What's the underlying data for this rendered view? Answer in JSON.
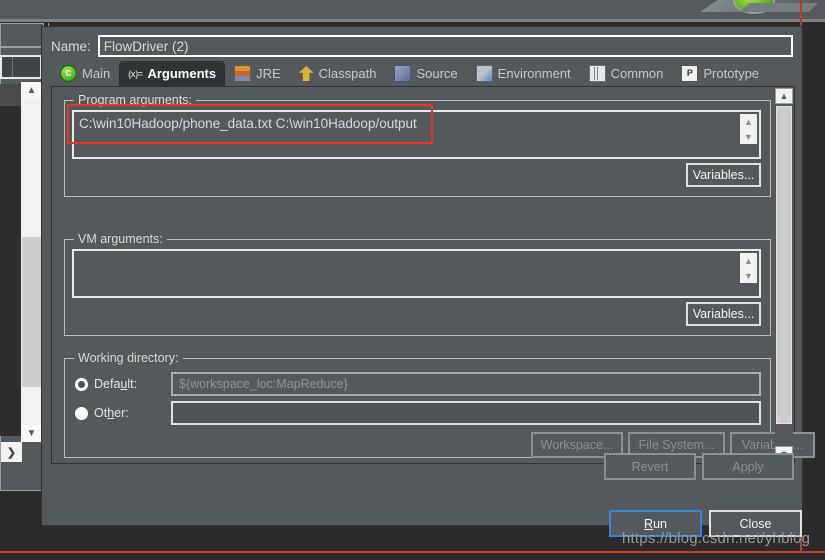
{
  "dialog": {
    "name_label": "Name:",
    "name_value": "FlowDriver (2)",
    "tabs": [
      {
        "label": "Main",
        "icon": "java-class-icon",
        "active": false
      },
      {
        "label": "Arguments",
        "icon": "arguments-variable-icon",
        "active": true
      },
      {
        "label": "JRE",
        "icon": "jre-books-icon",
        "active": false
      },
      {
        "label": "Classpath",
        "icon": "classpath-arrows-icon",
        "active": false
      },
      {
        "label": "Source",
        "icon": "source-pencil-icon",
        "active": false
      },
      {
        "label": "Environment",
        "icon": "environment-icon",
        "active": false
      },
      {
        "label": "Common",
        "icon": "common-window-icon",
        "active": false
      },
      {
        "label": "Prototype",
        "icon": "prototype-p-icon",
        "active": false
      }
    ],
    "program_arguments": {
      "title": "Program arguments:",
      "value": "C:\\win10Hadoop/phone_data.txt C:\\win10Hadoop/output",
      "variables_button": "Variables..."
    },
    "vm_arguments": {
      "title": "VM arguments:",
      "value": "",
      "variables_button": "Variables..."
    },
    "working_directory": {
      "title": "Working directory:",
      "default_label": "Default:",
      "default_label_prefix": "Defa",
      "default_label_mnemonic": "u",
      "default_label_suffix": "lt:",
      "default_value": "${workspace_loc:MapReduce}",
      "default_selected": true,
      "other_label_prefix": "Ot",
      "other_label_mnemonic": "h",
      "other_label_suffix": "er:",
      "other_value": "",
      "other_selected": false,
      "buttons": [
        "Workspace...",
        "File System...",
        "Variables..."
      ]
    },
    "footer_buttons": {
      "revert": "Revert",
      "apply": "Apply"
    }
  },
  "window_buttons": {
    "run_prefix": "",
    "run_mnemonic": "R",
    "run_suffix": "un",
    "run_full": "Run",
    "close": "Close"
  },
  "watermark": "https://blog.csdn.net/yhblog",
  "colors": {
    "dialog_bg": "#545a5b",
    "panel_border": "#b9bdbd",
    "text": "#d8d8d8",
    "accent_focus": "#2f86d6",
    "annotation_red": "#e8322b",
    "ide_dark": "#2b2b2b"
  }
}
